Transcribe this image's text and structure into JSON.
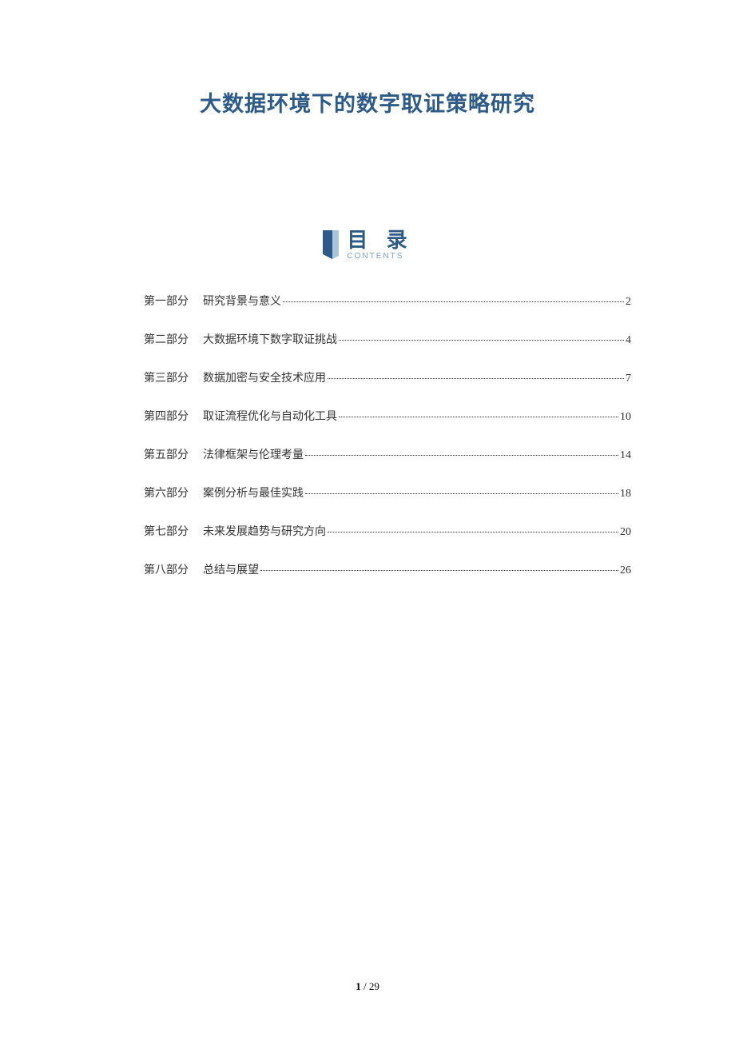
{
  "title": "大数据环境下的数字取证策略研究",
  "toc_header": {
    "cn": "目 录",
    "en": "CONTENTS"
  },
  "toc": [
    {
      "part": "第一部分",
      "chapter": "研究背景与意义",
      "page": "2"
    },
    {
      "part": "第二部分",
      "chapter": "大数据环境下数字取证挑战",
      "page": "4"
    },
    {
      "part": "第三部分",
      "chapter": "数据加密与安全技术应用",
      "page": "7"
    },
    {
      "part": "第四部分",
      "chapter": "取证流程优化与自动化工具",
      "page": "10"
    },
    {
      "part": "第五部分",
      "chapter": "法律框架与伦理考量",
      "page": "14"
    },
    {
      "part": "第六部分",
      "chapter": "案例分析与最佳实践",
      "page": "18"
    },
    {
      "part": "第七部分",
      "chapter": "未来发展趋势与研究方向",
      "page": "20"
    },
    {
      "part": "第八部分",
      "chapter": "总结与展望",
      "page": "26"
    }
  ],
  "footer": {
    "current": "1",
    "sep": " / ",
    "total": "29"
  }
}
